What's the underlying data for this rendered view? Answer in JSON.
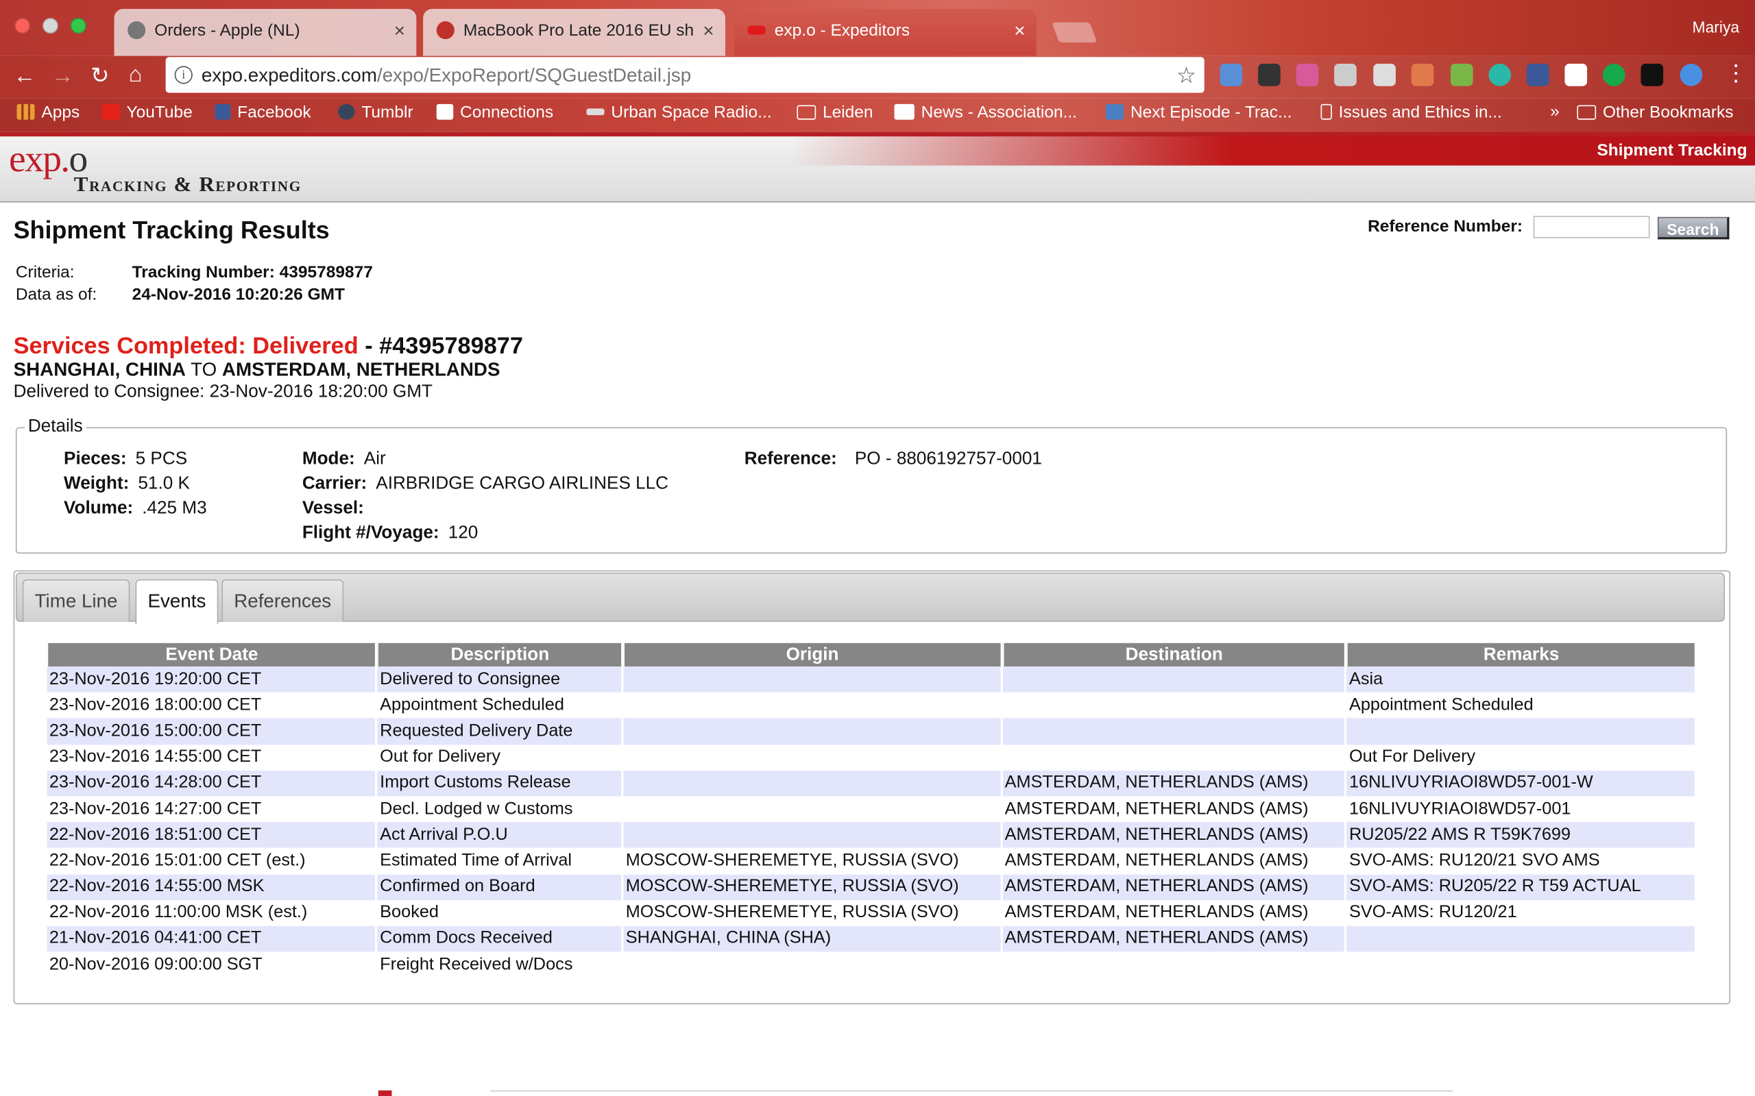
{
  "browser": {
    "tabs": [
      {
        "title": "Orders - Apple (NL)"
      },
      {
        "title": "MacBook Pro Late 2016 EU sh"
      },
      {
        "title": "exp.o - Expeditors"
      }
    ],
    "profile_name": "Mariya",
    "url_host": "expo.expeditors.com",
    "url_path": "/expo/ExpoReport/SQGuestDetail.jsp",
    "bookmarks": [
      {
        "label": "Apps"
      },
      {
        "label": "YouTube"
      },
      {
        "label": "Facebook"
      },
      {
        "label": "Tumblr"
      },
      {
        "label": "Connections"
      },
      {
        "label": "Urban Space Radio..."
      },
      {
        "label": "Leiden"
      },
      {
        "label": "News - Association..."
      },
      {
        "label": "Next Episode - Trac..."
      },
      {
        "label": "Issues and Ethics in..."
      }
    ],
    "overflow_label": "»",
    "other_bookmarks": "Other Bookmarks"
  },
  "site": {
    "logo_main": "exp.",
    "logo_o": "o",
    "logo_sub": "Tracking & Reporting",
    "section_title": "Shipment Tracking"
  },
  "page": {
    "title": "Shipment Tracking Results",
    "reference_label": "Reference Number:",
    "reference_value": "",
    "search_label": "Search",
    "criteria_label": "Criteria:",
    "criteria_value": "Tracking Number: 4395789877",
    "data_as_of_label": "Data as of:",
    "data_as_of_value": "24-Nov-2016 10:20:26 GMT",
    "status_text": "Services Completed: Delivered",
    "status_number": " - #4395789877",
    "route_from": "SHANGHAI, CHINA",
    "route_to_word": " TO ",
    "route_to": "AMSTERDAM, NETHERLANDS",
    "delivered_line": "Delivered to Consignee: 23-Nov-2016 18:20:00 GMT"
  },
  "details": {
    "legend": "Details",
    "pieces_label": "Pieces:",
    "pieces_value": "5 PCS",
    "weight_label": "Weight:",
    "weight_value": "51.0 K",
    "volume_label": "Volume:",
    "volume_value": ".425 M3",
    "mode_label": "Mode:",
    "mode_value": "Air",
    "carrier_label": "Carrier:",
    "carrier_value": "AIRBRIDGE CARGO AIRLINES LLC",
    "vessel_label": "Vessel:",
    "vessel_value": "",
    "flight_label": "Flight #/Voyage:",
    "flight_value": "120",
    "reference_label": "Reference:",
    "reference_value": "PO - 8806192757-0001"
  },
  "tabs": [
    {
      "label": "Time Line",
      "active": false
    },
    {
      "label": "Events",
      "active": true
    },
    {
      "label": "References",
      "active": false
    }
  ],
  "events": {
    "headers": [
      "Event Date",
      "Description",
      "Origin",
      "Destination",
      "Remarks"
    ],
    "rows": [
      [
        "23-Nov-2016 19:20:00 CET",
        "Delivered to Consignee",
        "",
        "",
        "Asia"
      ],
      [
        "23-Nov-2016 18:00:00 CET",
        "Appointment Scheduled",
        "",
        "",
        "Appointment Scheduled"
      ],
      [
        "23-Nov-2016 15:00:00 CET",
        "Requested Delivery Date",
        "",
        "",
        ""
      ],
      [
        "23-Nov-2016 14:55:00 CET",
        "Out for Delivery",
        "",
        "",
        "Out For Delivery"
      ],
      [
        "23-Nov-2016 14:28:00 CET",
        "Import Customs Release",
        "",
        "AMSTERDAM, NETHERLANDS (AMS)",
        "16NLIVUYRIAOI8WD57-001-W"
      ],
      [
        "23-Nov-2016 14:27:00 CET",
        "Decl. Lodged w Customs",
        "",
        "AMSTERDAM, NETHERLANDS (AMS)",
        "16NLIVUYRIAOI8WD57-001"
      ],
      [
        "22-Nov-2016 18:51:00 CET",
        "Act Arrival P.O.U",
        "",
        "AMSTERDAM, NETHERLANDS (AMS)",
        "RU205/22 AMS R T59K7699"
      ],
      [
        "22-Nov-2016 15:01:00 CET (est.)",
        "Estimated Time of Arrival",
        "MOSCOW-SHEREMETYE, RUSSIA (SVO)",
        "AMSTERDAM, NETHERLANDS (AMS)",
        "SVO-AMS: RU120/21 SVO AMS"
      ],
      [
        "22-Nov-2016 14:55:00 MSK",
        "Confirmed on Board",
        "MOSCOW-SHEREMETYE, RUSSIA (SVO)",
        "AMSTERDAM, NETHERLANDS (AMS)",
        "SVO-AMS: RU205/22 R T59 ACTUAL"
      ],
      [
        "22-Nov-2016 11:00:00 MSK (est.)",
        "Booked",
        "MOSCOW-SHEREMETYE, RUSSIA (SVO)",
        "AMSTERDAM, NETHERLANDS (AMS)",
        "SVO-AMS: RU120/21"
      ],
      [
        "21-Nov-2016 04:41:00 CET",
        "Comm Docs Received",
        "SHANGHAI, CHINA (SHA)",
        "AMSTERDAM, NETHERLANDS (AMS)",
        ""
      ],
      [
        "20-Nov-2016 09:00:00 SGT",
        "Freight Received w/Docs",
        "",
        "",
        ""
      ]
    ]
  },
  "colors": {
    "brand_red": "#c11d2a",
    "status_red": "#e0201b",
    "table_header": "#868686",
    "row_alt": "#e3e6fb"
  }
}
